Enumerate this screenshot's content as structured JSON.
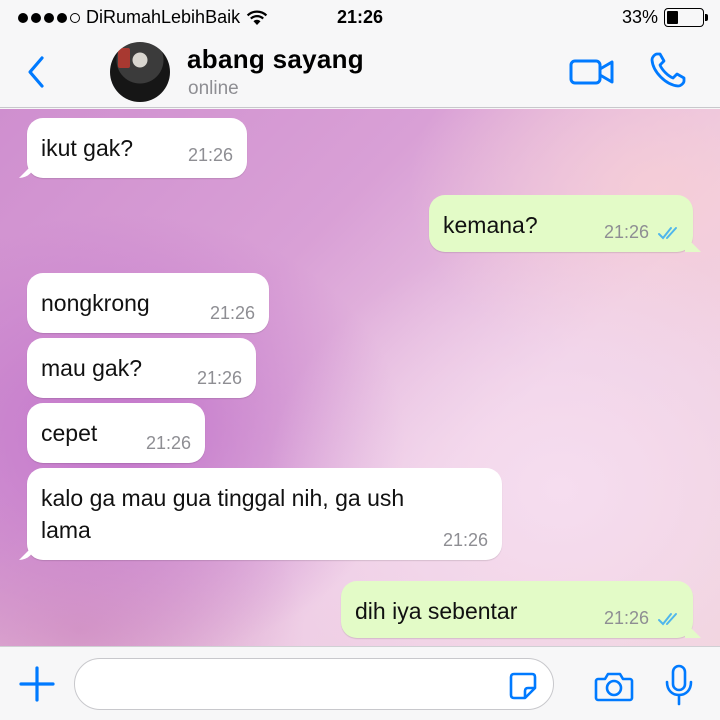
{
  "status_bar": {
    "carrier": "DiRumahLebihBaik",
    "time": "21:26",
    "battery_percent": "33%",
    "battery_level": 0.33,
    "signal_dots_filled": 4,
    "signal_dots_total": 5
  },
  "header": {
    "back_icon": "chevron-left-icon",
    "contact_name": "abang sayang",
    "contact_status": "online",
    "video_icon": "video-camera-icon",
    "call_icon": "phone-icon"
  },
  "messages": [
    {
      "direction": "in",
      "text": "ikut gak?",
      "time": "21:26"
    },
    {
      "direction": "out",
      "text": "kemana?",
      "time": "21:26",
      "read": true
    },
    {
      "direction": "in",
      "text": "nongkrong",
      "time": "21:26"
    },
    {
      "direction": "in",
      "text": "mau gak?",
      "time": "21:26"
    },
    {
      "direction": "in",
      "text": "cepet",
      "time": "21:26"
    },
    {
      "direction": "in",
      "text": "kalo ga mau gua tinggal nih, ga ush\nlama",
      "line1": "kalo ga mau gua tinggal nih, ga ush",
      "line2": "lama",
      "time": "21:26"
    },
    {
      "direction": "out",
      "text": "dih iya sebentar",
      "time": "21:26",
      "read": true
    }
  ],
  "input_bar": {
    "plus_icon": "plus-icon",
    "message_value": "",
    "sticker_icon": "sticker-icon",
    "camera_icon": "camera-icon",
    "mic_icon": "microphone-icon"
  },
  "colors": {
    "accent": "#007aff",
    "incoming_bubble": "#ffffff",
    "outgoing_bubble": "#e3fbc7",
    "read_ticks": "#4fb6ec",
    "timestamp": "#8e8e93"
  }
}
